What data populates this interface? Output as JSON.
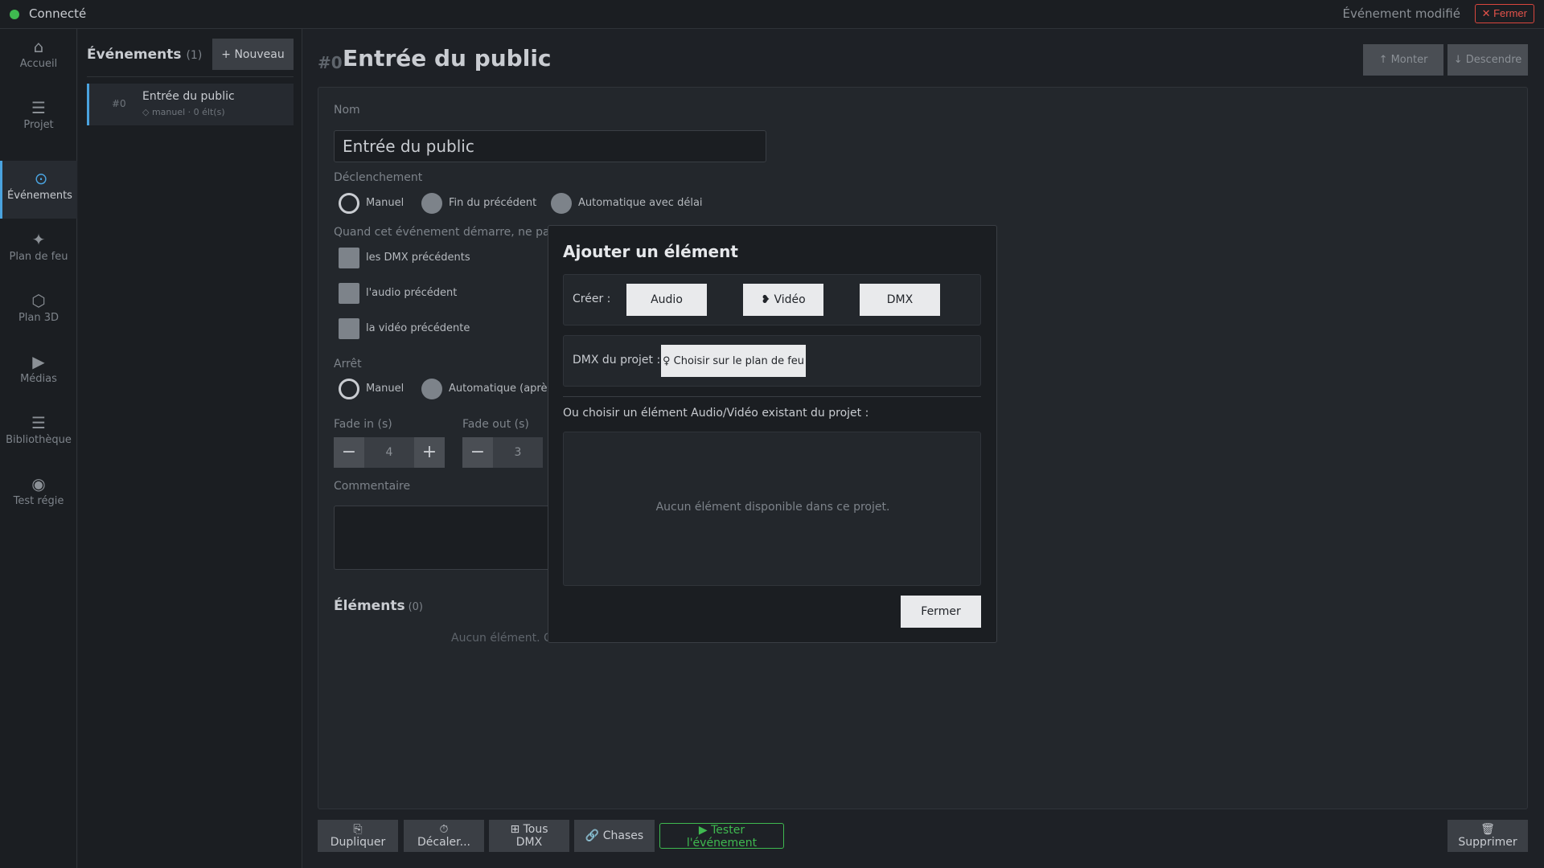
{
  "topbar": {
    "status": "Connecté",
    "modified": "Événement modifié",
    "close": "✕ Fermer"
  },
  "nav": {
    "items": [
      {
        "icon": "⌂",
        "label": "Accueil"
      },
      {
        "icon": "☰",
        "label": "Projet"
      },
      {
        "icon": "⊙",
        "label": "Événements"
      },
      {
        "icon": "✦",
        "label": "Plan de feu"
      },
      {
        "icon": "⬡",
        "label": "Plan 3D"
      },
      {
        "icon": "▶",
        "label": "Médias"
      },
      {
        "icon": "☰",
        "label": "Bibliothèque"
      },
      {
        "icon": "◉",
        "label": "Test régie"
      }
    ]
  },
  "list": {
    "title": "Événements",
    "count": "(1)",
    "new": "+ Nouveau",
    "events": [
      {
        "num": "#0",
        "name": "Entrée du public",
        "meta": "◇ manuel · 0 élt(s)"
      }
    ]
  },
  "main": {
    "num": "#0",
    "title": "Entrée du public",
    "up": "↑ Monter",
    "down": "↓ Descendre",
    "name_label": "Nom",
    "name_value": "Entrée du public",
    "trigger_label": "Déclenchement",
    "trigger_options": [
      "Manuel",
      "Fin du précédent",
      "Automatique avec délai"
    ],
    "stop_prev_label": "Quand cet événement démarre, ne pas a",
    "stop_prev_options": [
      "les DMX précédents",
      "l'audio précédent",
      "la vidéo précédente"
    ],
    "stop_label": "Arrêt",
    "stop_options": [
      "Manuel",
      "Automatique (aprè"
    ],
    "fade_in_label": "Fade in (s)",
    "fade_in_value": "4",
    "fade_out_label": "Fade out (s)",
    "fade_out_value": "3",
    "comment_label": "Commentaire",
    "elements_title": "Éléments",
    "elements_count": "(0)",
    "elements_empty": "Aucun élément. Cl"
  },
  "bottom": {
    "duplicate": "⎘ Dupliquer",
    "shift": "⏱ Décaler...",
    "all_dmx": "⊞ Tous DMX",
    "chases": "🔗 Chases",
    "test": "▶ Tester l'événement",
    "delete": "🗑 Supprimer"
  },
  "modal": {
    "title": "Ajouter un élément",
    "create_label": "Créer :",
    "create_audio": "Audio",
    "create_video": "❥ Vidéo",
    "create_dmx": "DMX",
    "dmx_label": "DMX du projet :",
    "pick": "♀ Choisir sur le plan de feu",
    "or_label": "Ou choisir un élément Audio/Vidéo existant du projet :",
    "empty": "Aucun élément disponible dans ce projet.",
    "close": "Fermer"
  }
}
